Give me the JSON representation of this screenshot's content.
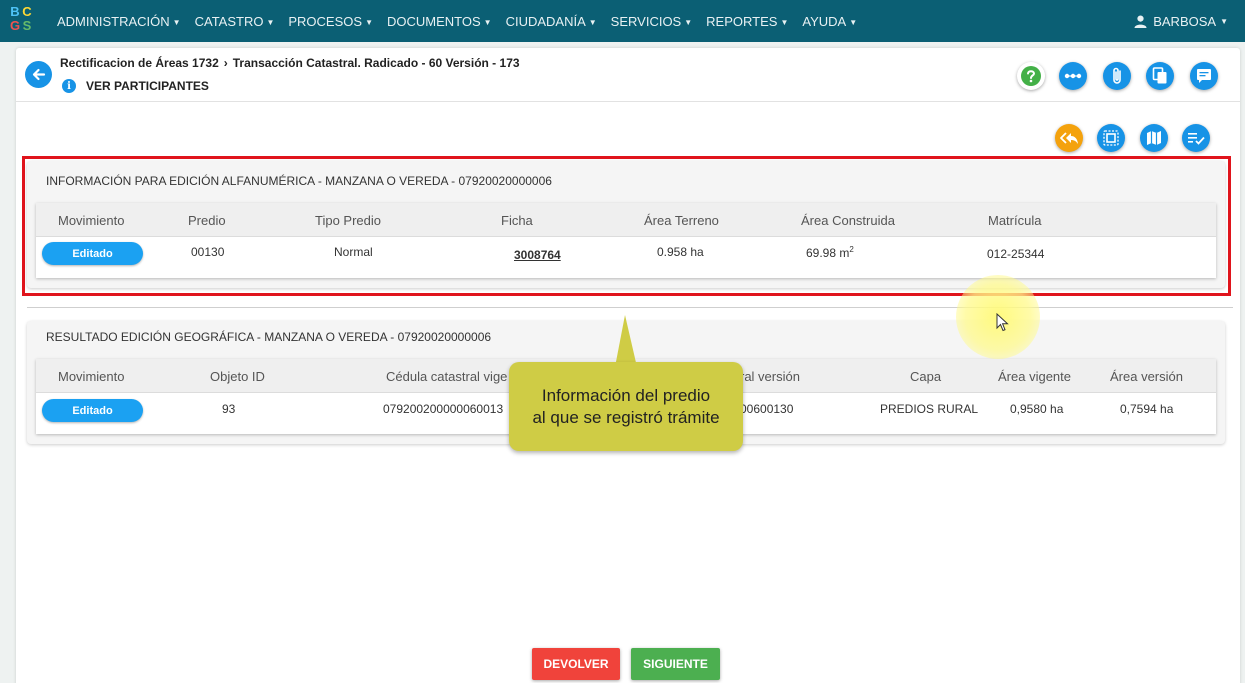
{
  "nav": {
    "logo_letters": [
      "B",
      "C",
      "G",
      "S"
    ],
    "menu": [
      "ADMINISTRACIÓN",
      "CATASTRO",
      "PROCESOS",
      "DOCUMENTOS",
      "CIUDADANÍA",
      "SERVICIOS",
      "REPORTES",
      "AYUDA"
    ],
    "user": "BARBOSA"
  },
  "header": {
    "breadcrumb_1": "Rectificacion de Áreas 1732",
    "breadcrumb_2": "Transacción Catastral. Radicado - 60 Versión - 173",
    "participants": "VER PARTICIPANTES",
    "info_icon_text": "i"
  },
  "alfa": {
    "title": "INFORMACIÓN PARA EDICIÓN ALFANUMÉRICA - MANZANA O VEREDA - 07920020000006",
    "headers": [
      "Movimiento",
      "Predio",
      "Tipo Predio",
      "Ficha",
      "Área Terreno",
      "Área Construida",
      "Matrícula"
    ],
    "row": {
      "movimiento": "Editado",
      "predio": "00130",
      "tipo": "Normal",
      "ficha": "3008764",
      "area_terreno": "0.958 ha",
      "area_construida": "69.98 m",
      "area_construida_sup": "2",
      "matricula": "012-25344"
    }
  },
  "geo": {
    "title": "RESULTADO EDICIÓN GEOGRÁFICA - MANZANA O VEREDA - 07920020000006",
    "headers": [
      "Movimiento",
      "Objeto ID",
      "Cédula catastral vige",
      "ral versión",
      "Capa",
      "Área vigente",
      "Área versión"
    ],
    "row": {
      "movimiento": "Editado",
      "objeto_id": "93",
      "cedula": "079200200000060013",
      "cedula_version": "00600130",
      "capa": "PREDIOS RURAL",
      "area_vigente": "0,9580 ha",
      "area_version": "0,7594 ha"
    }
  },
  "callout": {
    "line1": "Información del predio",
    "line2": "al que se registró trámite"
  },
  "footer": {
    "devolver": "DEVOLVER",
    "siguiente": "SIGUIENTE"
  },
  "colors": {
    "navbar": "#0b5f74",
    "primary": "#1793e6",
    "highlight_border": "#e0141c",
    "callout": "#cfcc45",
    "devolver": "#f0433b",
    "siguiente": "#4caf50",
    "orange_action": "#f4a20d"
  }
}
